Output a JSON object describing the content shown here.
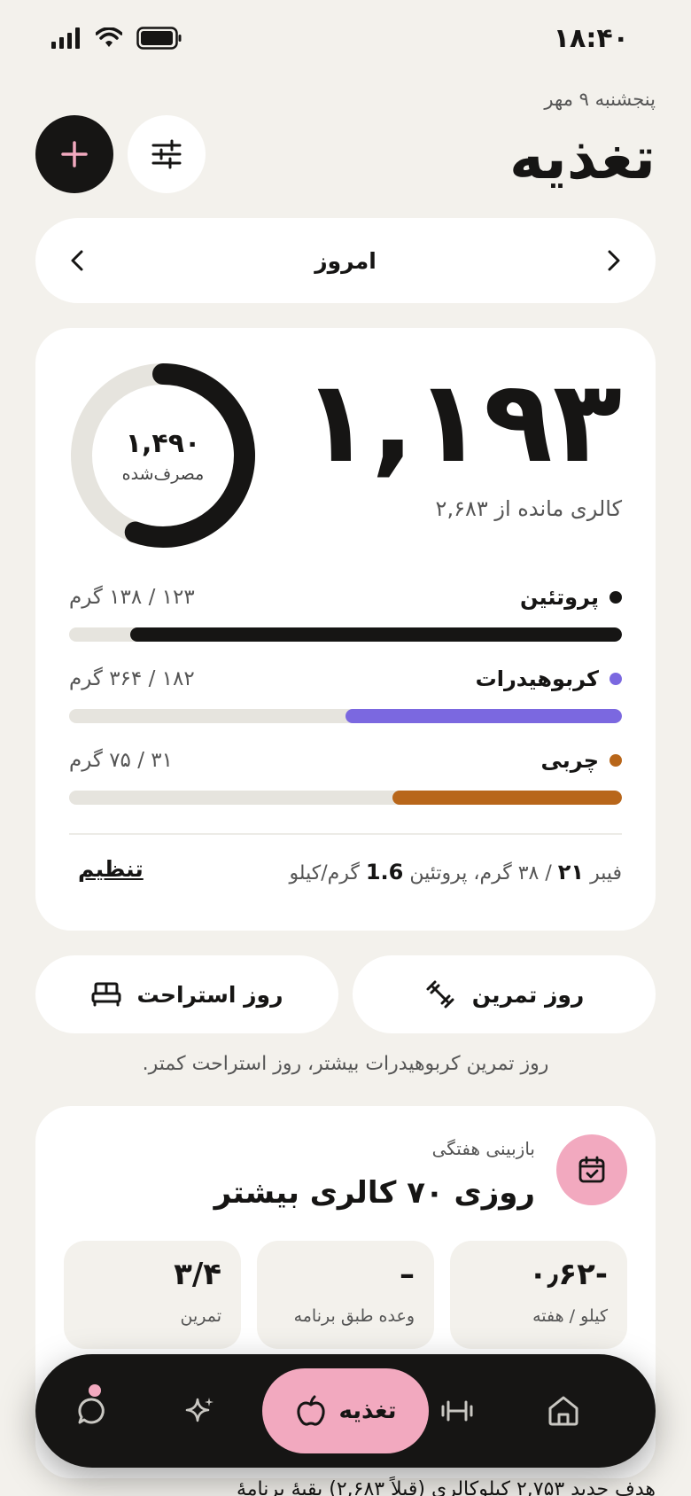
{
  "status_bar": {
    "time": "۱۸:۴۰"
  },
  "header": {
    "date": "پنجشنبه ۹ مهر",
    "title": "تغذیه"
  },
  "day_nav": {
    "label": "امروز"
  },
  "calories": {
    "remaining": "۱,۱۹۳",
    "remaining_label": "کالری مانده از ۲,۶۸۳",
    "consumed": "۱,۴۹۰",
    "consumed_label": "مصرف‌شده",
    "consumed_fraction": 0.555
  },
  "macros": [
    {
      "name": "پروتئین",
      "amount": "۱۲۳ / ۱۳۸ گرم",
      "fraction": 0.89,
      "color": "#161514"
    },
    {
      "name": "کربوهیدرات",
      "amount": "۱۸۲ / ۳۶۴ گرم",
      "fraction": 0.5,
      "color": "#7b68e0"
    },
    {
      "name": "چربی",
      "amount": "۳۱ / ۷۵ گرم",
      "fraction": 0.415,
      "color": "#b8661a"
    }
  ],
  "fiber": {
    "prefix": "فیبر",
    "value": "۲۱",
    "middle": "/ ۳۸ گرم، پروتئین",
    "protein_ratio": "1.6",
    "suffix": "گرم/کیلو"
  },
  "settings_link": "تنظیم",
  "day_types": {
    "training": "روز تمرین",
    "rest": "روز استراحت"
  },
  "hint": "روز تمرین کربوهیدرات بیشتر، روز استراحت کمتر.",
  "weekly": {
    "label": "بازبینی هفتگی",
    "title": "روزی ۷۰ کالری بیشتر",
    "stats": [
      {
        "value": "-۰٫۶۲",
        "label": "کیلو / هفته"
      },
      {
        "value": "–",
        "label": "وعده طبق برنامه"
      },
      {
        "value": "۳/۴",
        "label": "تمرین"
      }
    ]
  },
  "bottom_peek": "هدف جدید ۲,۷۵۳ کیلوکالری (قبلاً ۲,۶۸۳) بقیهٔ برنامهٔ",
  "tab_bar": {
    "active_label": "تغذیه",
    "active_color": "#f2a9bf"
  },
  "colors": {
    "background": "#f3f1ec",
    "card": "#ffffff",
    "dark": "#161514",
    "accent_pink": "#f2a9bf"
  }
}
